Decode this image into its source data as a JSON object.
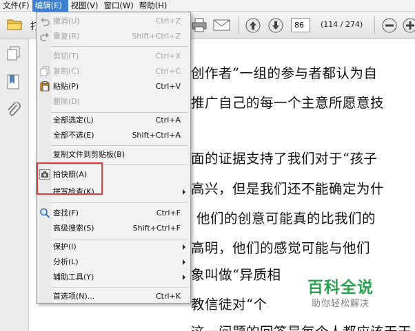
{
  "menubar": [
    {
      "label": "文件(F)",
      "active": false
    },
    {
      "label": "编辑(E)",
      "active": true
    },
    {
      "label": "视图(V)",
      "active": false
    },
    {
      "label": "窗口(W)",
      "active": false
    },
    {
      "label": "帮助(H)",
      "active": false
    }
  ],
  "toolbar": {
    "partial_text": "打",
    "page_number": "86",
    "page_count": "(114 / 274)"
  },
  "edit_menu": [
    {
      "label": "撤消(U)",
      "shortcut": "Ctrl+Z",
      "disabled": true,
      "icon": "undo-icon"
    },
    {
      "label": "重复(R)",
      "shortcut": "Shift+Ctrl+Z",
      "disabled": true,
      "icon": "redo-icon"
    },
    {
      "label": "剪切(T)",
      "shortcut": "Ctrl+X",
      "disabled": true,
      "icon": ""
    },
    {
      "label": "复制(C)",
      "shortcut": "Ctrl+C",
      "disabled": true,
      "icon": "copy-icon"
    },
    {
      "label": "粘贴(P)",
      "shortcut": "Ctrl+V",
      "disabled": false,
      "icon": "paste-icon"
    },
    {
      "label": "删除(D)",
      "shortcut": "",
      "disabled": true,
      "icon": ""
    },
    {
      "label": "全部选定(L)",
      "shortcut": "Ctrl+A",
      "disabled": false,
      "icon": ""
    },
    {
      "label": "全部不选(E)",
      "shortcut": "Shift+Ctrl+A",
      "disabled": false,
      "icon": ""
    },
    {
      "label": "复制文件到剪贴板(B)",
      "shortcut": "",
      "disabled": false,
      "icon": ""
    },
    {
      "label": "拍快照(A)",
      "shortcut": "",
      "disabled": false,
      "icon": "camera-icon"
    },
    {
      "label": "拼写检查(K)",
      "shortcut": "",
      "disabled": false,
      "icon": "",
      "submenu": true
    },
    {
      "label": "查找(F)",
      "shortcut": "Ctrl+F",
      "disabled": false,
      "icon": "search-icon"
    },
    {
      "label": "高级搜索(S)",
      "shortcut": "Shift+Ctrl+F",
      "disabled": false,
      "icon": ""
    },
    {
      "label": "保护(I)",
      "shortcut": "",
      "disabled": false,
      "icon": "",
      "submenu": true
    },
    {
      "label": "分析(L)",
      "shortcut": "",
      "disabled": false,
      "icon": "",
      "submenu": true
    },
    {
      "label": "辅助工具(Y)",
      "shortcut": "",
      "disabled": false,
      "icon": "",
      "submenu": true
    },
    {
      "label": "首选项(N)...",
      "shortcut": "Ctrl+K",
      "disabled": false,
      "icon": ""
    }
  ],
  "document_lines": [
    "创作者”一组的参与者都认为自",
    "推广自己的每一个主意所愿意技",
    "面的证据支持了我们对于“孩子",
    "高兴，但是我们还不能确定为什",
    "他们的创意可能真的比我们的",
    "高明，他们的感觉可能与他们",
    "象叫做“异质相",
    "教信徒对“个",
    "这一问题的回答是每个人都应该无干"
  ],
  "watermark": {
    "title": "百科全说",
    "subtitle": "助你轻松解决"
  },
  "colors": {
    "menu_active": "#3d7fd0",
    "highlight_box": "#e53b3b",
    "watermark_green": "#2aa44f"
  }
}
